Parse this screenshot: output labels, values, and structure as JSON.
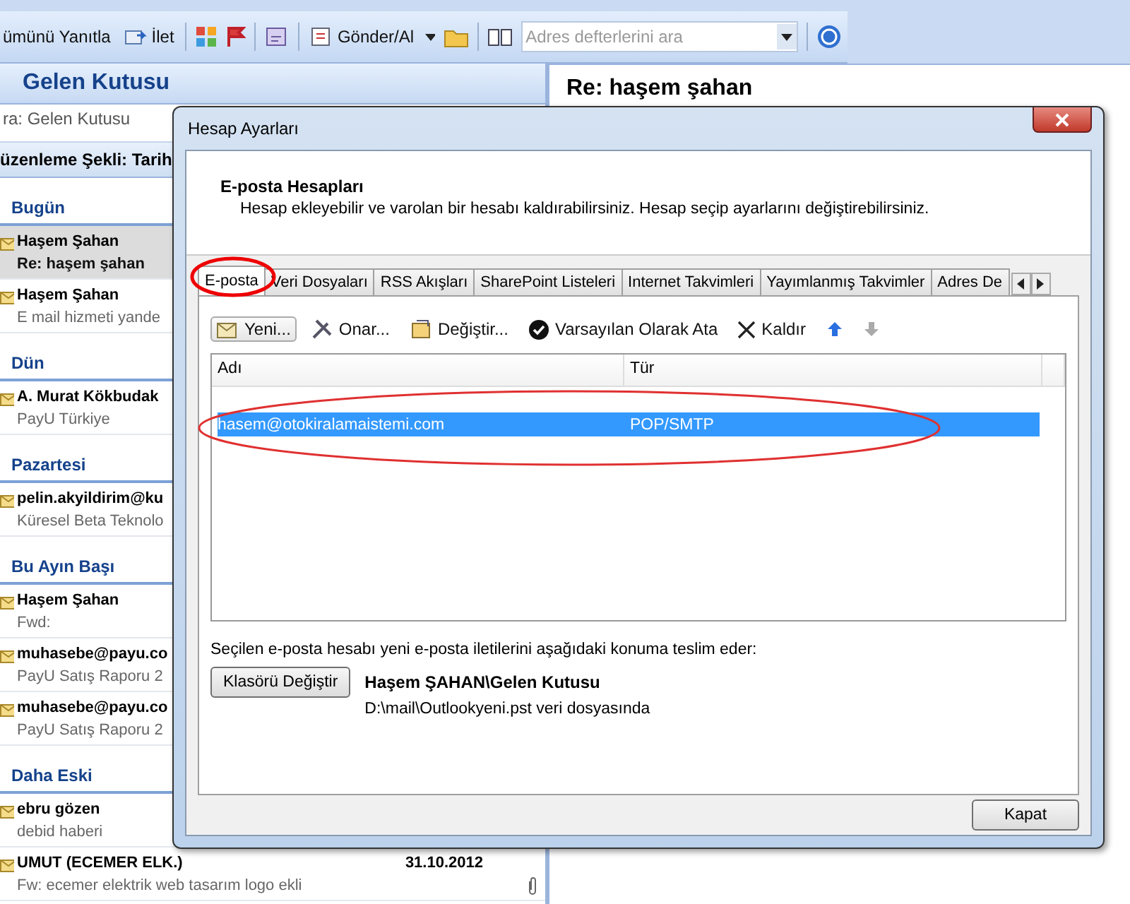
{
  "toolbar": {
    "reply_all": "ümünü Yanıtla",
    "forward": "İlet",
    "send_receive": "Gönder/Al",
    "search": {
      "placeholder": "Adres defterlerini ara"
    }
  },
  "mail_pane": {
    "title": "Gelen Kutusu",
    "search": {
      "placeholder": "ra: Gelen Kutusu"
    },
    "arrange_by": "üzenleme Şekli: Tarih",
    "groups": [
      {
        "label": "Bugün",
        "items": [
          {
            "name": "Haşem Şahan",
            "subject": "Re: haşem şahan",
            "selected": true
          },
          {
            "name": "Haşem Şahan",
            "subject": "E mail hizmeti yande",
            "selected": false
          }
        ]
      },
      {
        "label": "Dün",
        "items": [
          {
            "name": "A. Murat Kökbudak",
            "subject": "PayU Türkiye",
            "selected": false
          }
        ]
      },
      {
        "label": "Pazartesi",
        "items": [
          {
            "name": "pelin.akyildirim@ku",
            "subject": "Küresel Beta Teknolo",
            "selected": false
          }
        ]
      },
      {
        "label": "Bu Ayın Başı",
        "items": [
          {
            "name": "Haşem Şahan",
            "subject": "Fwd:",
            "selected": false
          },
          {
            "name": "muhasebe@payu.co",
            "subject": "PayU Satış Raporu 2",
            "selected": false
          },
          {
            "name": "muhasebe@payu.co",
            "subject": "PayU Satış Raporu 2",
            "selected": false
          }
        ]
      },
      {
        "label": "Daha Eski",
        "items": [
          {
            "name": "ebru gözen",
            "subject": "debid haberi",
            "selected": false
          },
          {
            "name": "UMUT (ECEMER ELK.)",
            "subject": "Fw: ecemer elektrik web tasarım  logo ekli",
            "date": "31.10.2012",
            "selected": false
          }
        ]
      }
    ]
  },
  "reading_pane": {
    "subject": "Re: haşem şahan"
  },
  "dialog": {
    "title": "Hesap Ayarları",
    "heading": "E-posta Hesapları",
    "description": "Hesap ekleyebilir ve varolan bir hesabı kaldırabilirsiniz. Hesap seçip ayarlarını değiştirebilirsiniz.",
    "tabs": [
      {
        "label": "E-posta",
        "selected": true
      },
      {
        "label": "Veri Dosyaları",
        "selected": false
      },
      {
        "label": "RSS Akışları",
        "selected": false
      },
      {
        "label": "SharePoint Listeleri",
        "selected": false
      },
      {
        "label": "Internet Takvimleri",
        "selected": false
      },
      {
        "label": "Yayımlanmış Takvimler",
        "selected": false
      },
      {
        "label": "Adres De",
        "selected": false
      }
    ],
    "actions": {
      "new": "Yeni...",
      "repair": "Onar...",
      "change": "Değiştir...",
      "set_default": "Varsayılan Olarak Ata",
      "remove": "Kaldır",
      "move_up": {
        "disabled": false
      },
      "move_down": {
        "disabled": true
      }
    },
    "table": {
      "columns": [
        "Adı",
        "Tür"
      ],
      "rows": [
        {
          "cells": [
            "hasem@otokiralamaistemi.com",
            "POP/SMTP"
          ],
          "selected": true
        }
      ]
    },
    "delivery_note": "Seçilen e-posta hesabı yeni e-posta iletilerini aşağıdaki konuma teslim eder:",
    "change_folder": "Klasörü Değiştir",
    "folder": "Haşem ŞAHAN\\Gelen Kutusu",
    "data_file": "D:\\mail\\Outlookyeni.pst veri dosyasında",
    "close": "Kapat"
  }
}
